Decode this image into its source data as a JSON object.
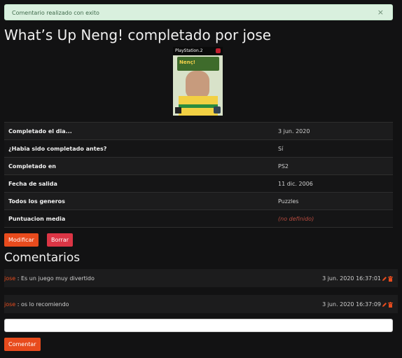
{
  "alert": {
    "message": "Comentario realizado con exito",
    "close": "×"
  },
  "title": "What’s Up Neng! completado por jose",
  "cover": {
    "platform": "PlayStation.2",
    "logo_text": "Nenç!"
  },
  "details": [
    {
      "label": "Completado el dia...",
      "value": "3 jun. 2020"
    },
    {
      "label": "¿Habia sido completado antes?",
      "value": "Sí"
    },
    {
      "label": "Completado en",
      "value": "PS2"
    },
    {
      "label": "Fecha de salida",
      "value": "11 dic. 2006"
    },
    {
      "label": "Todos los generos",
      "value": "Puzzles"
    },
    {
      "label": "Puntuacion media",
      "value": "(no definido)"
    }
  ],
  "buttons": {
    "modify": "Modificar",
    "delete": "Borrar",
    "comment": "Comentar"
  },
  "comments_title": "Comentarios",
  "comments": [
    {
      "author": "jose",
      "separator": " : ",
      "text": "Es un juego muy divertido",
      "timestamp": "3 jun. 2020 16:37:01"
    },
    {
      "author": "jose",
      "separator": " : ",
      "text": "os lo recomiendo",
      "timestamp": "3 jun. 2020 16:37:09"
    }
  ],
  "comment_input": {
    "value": "",
    "placeholder": ""
  },
  "colors": {
    "accent": "#e84b1d",
    "danger": "#dc3545",
    "background": "#121213",
    "alert_bg": "#d9f0de"
  },
  "icons": [
    "close-icon",
    "edit-pencil-icon",
    "trash-icon"
  ]
}
